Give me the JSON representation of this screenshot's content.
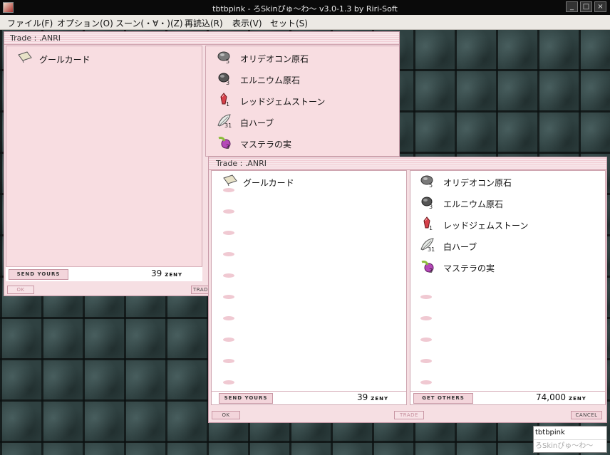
{
  "window": {
    "title": "tbtbpink - ろSkinぴゅ〜わ〜 v3.0-1.3 by Riri-Soft",
    "buttons": [
      "_",
      "□",
      "×"
    ]
  },
  "menu": [
    {
      "label": "ファイル(F)"
    },
    {
      "label": "オプション(O)"
    },
    {
      "label": "スーン(・∀・)(Z)"
    },
    {
      "label": "再読込(R)"
    },
    {
      "label": "表示(V)"
    },
    {
      "label": "セット(S)"
    }
  ],
  "trade_back": {
    "title": "Trade : .ANRI",
    "yours": [
      {
        "name": "グールカード",
        "qty": ""
      }
    ],
    "others": [
      {
        "name": "オリデオコン原石",
        "qty": "5",
        "icon": "ore-icon"
      },
      {
        "name": "エルニウム原石",
        "qty": "3",
        "icon": "ore-icon"
      },
      {
        "name": "レッドジェムストーン",
        "qty": "1",
        "icon": "gem-icon"
      },
      {
        "name": "白ハーブ",
        "qty": "31",
        "icon": "herb-icon"
      },
      {
        "name": "マステラの実",
        "qty": "3",
        "icon": "fruit-icon"
      }
    ],
    "send_tab": "SEND YOURS",
    "zeny_value": "39",
    "zeny_unit": "ZENY",
    "ok_label": "OK",
    "trade_label": "TRAD"
  },
  "trade_front": {
    "title": "Trade : .ANRI",
    "yours": [
      {
        "name": "グールカード",
        "qty": ""
      }
    ],
    "others": [
      {
        "name": "オリデオコン原石",
        "qty": "5",
        "icon": "ore-icon"
      },
      {
        "name": "エルニウム原石",
        "qty": "3",
        "icon": "ore-icon"
      },
      {
        "name": "レッドジェムストーン",
        "qty": "1",
        "icon": "gem-icon"
      },
      {
        "name": "白ハーブ",
        "qty": "31",
        "icon": "herb-icon"
      },
      {
        "name": "マステラの実",
        "qty": "3",
        "icon": "fruit-icon"
      }
    ],
    "send_tab": "SEND YOURS",
    "get_tab": "GET OTHERS",
    "your_zeny": "39",
    "other_zeny": "74,000",
    "zeny_unit": "ZENY",
    "ok_label": "OK",
    "trade_label": "TRADE",
    "cancel_label": "CANCEL"
  },
  "tooltip": {
    "line1": "tbtbpink",
    "line2": "ろSkinぴゅ〜わ〜"
  },
  "colors": {
    "pink_panel": "#f6dfe3",
    "pink_border": "#c79aa8",
    "titlebar": "#0a0a0a"
  }
}
